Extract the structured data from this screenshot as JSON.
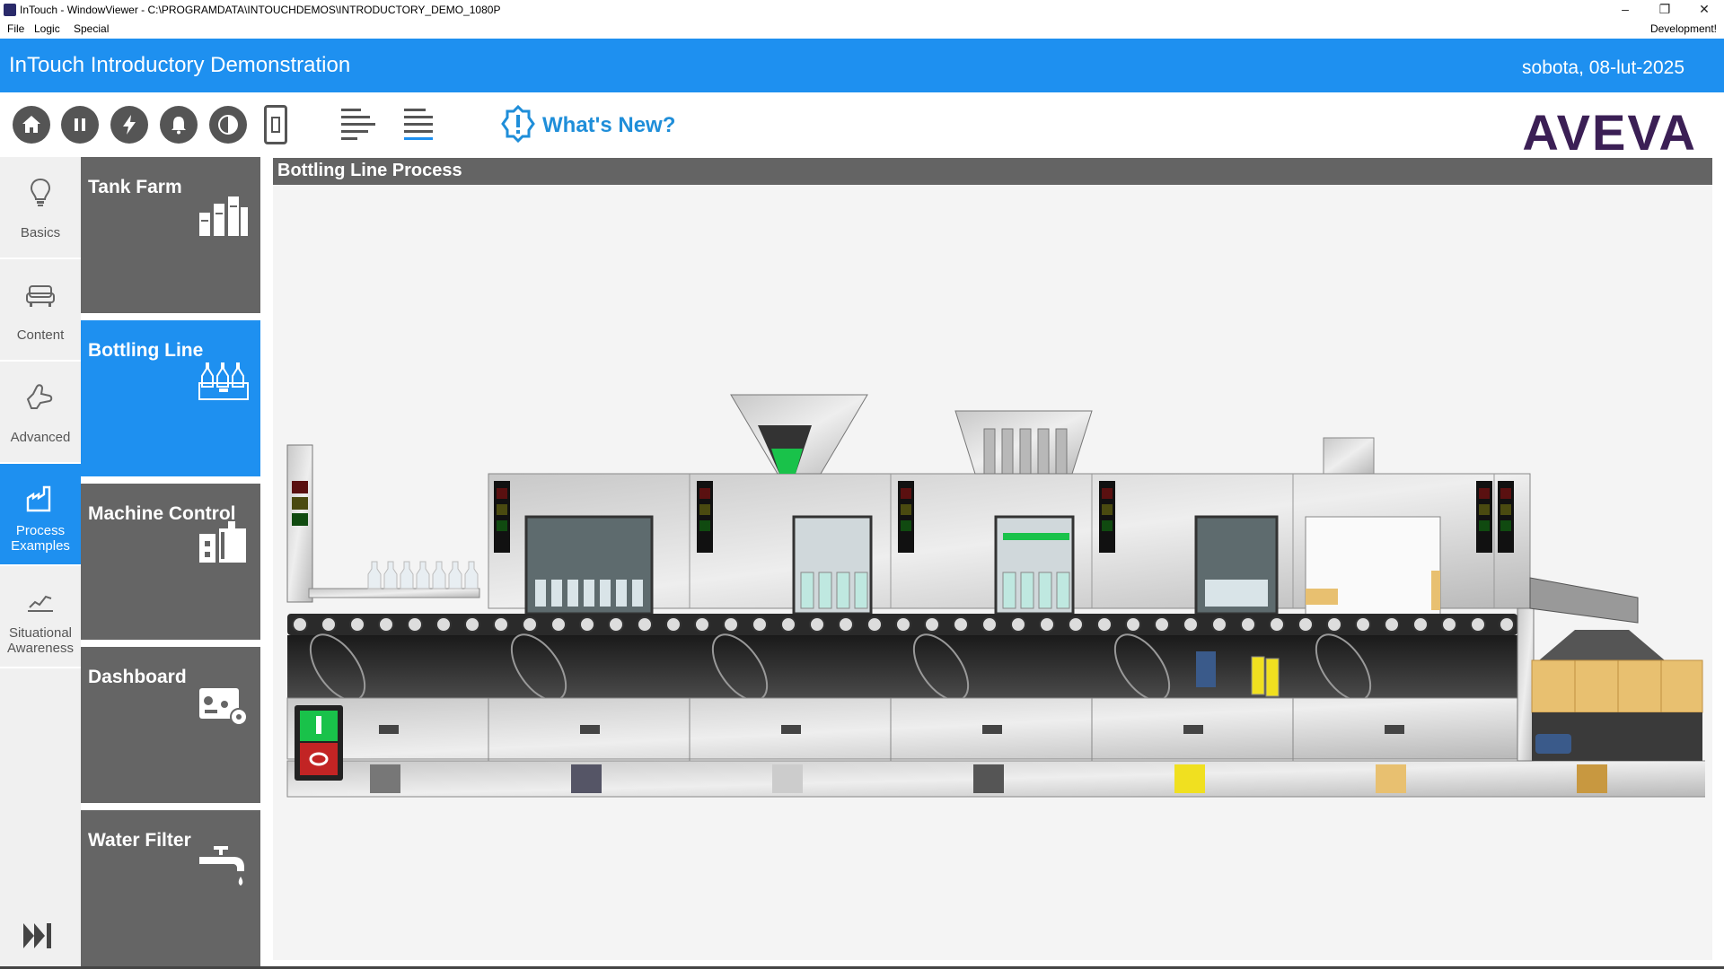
{
  "window": {
    "title": "InTouch - WindowViewer - C:\\PROGRAMDATA\\INTOUCHDEMOS\\INTRODUCTORY_DEMO_1080P",
    "controls": [
      "–",
      "❐",
      "✕"
    ]
  },
  "menu": {
    "items": [
      "File",
      "Logic",
      "Special"
    ],
    "status": "Development!"
  },
  "banner": {
    "title": "InTouch Introductory Demonstration",
    "date": "sobota, 08-lut-2025",
    "color": "#1e90f0"
  },
  "toolbar": {
    "buttons": [
      "home-icon",
      "pause-icon",
      "lightning-icon",
      "bell-icon",
      "contrast-icon",
      "device-icon",
      "align-left-icon",
      "align-justify-icon"
    ],
    "whats_new": "What's New?",
    "logo": "AVEVA"
  },
  "rail": {
    "items": [
      {
        "label": "Basics",
        "icon": "lightbulb-icon"
      },
      {
        "label": "Content",
        "icon": "sofa-icon"
      },
      {
        "label": "Advanced",
        "icon": "hand-icon"
      },
      {
        "label": "Process Examples",
        "icon": "factory-icon",
        "active": true
      },
      {
        "label": "Situational Awareness",
        "icon": "trend-chart-icon"
      }
    ],
    "skip_icon": "skip-forward-icon"
  },
  "tiles": [
    {
      "label": "Tank Farm",
      "icon": "tanks-icon"
    },
    {
      "label": "Bottling Line",
      "icon": "bottles-icon",
      "active": true
    },
    {
      "label": "Machine Control",
      "icon": "machine-icon"
    },
    {
      "label": "Dashboard",
      "icon": "dashboard-gear-icon"
    },
    {
      "label": "Water Filter",
      "icon": "faucet-icon"
    }
  ],
  "main": {
    "header": "Bottling Line Process"
  },
  "colors": {
    "accent": "#1e90f0",
    "tile": "#656565",
    "header": "#646464",
    "logo": "#3b1f55",
    "run_green": "#19c24a",
    "stop_red": "#c22424"
  }
}
